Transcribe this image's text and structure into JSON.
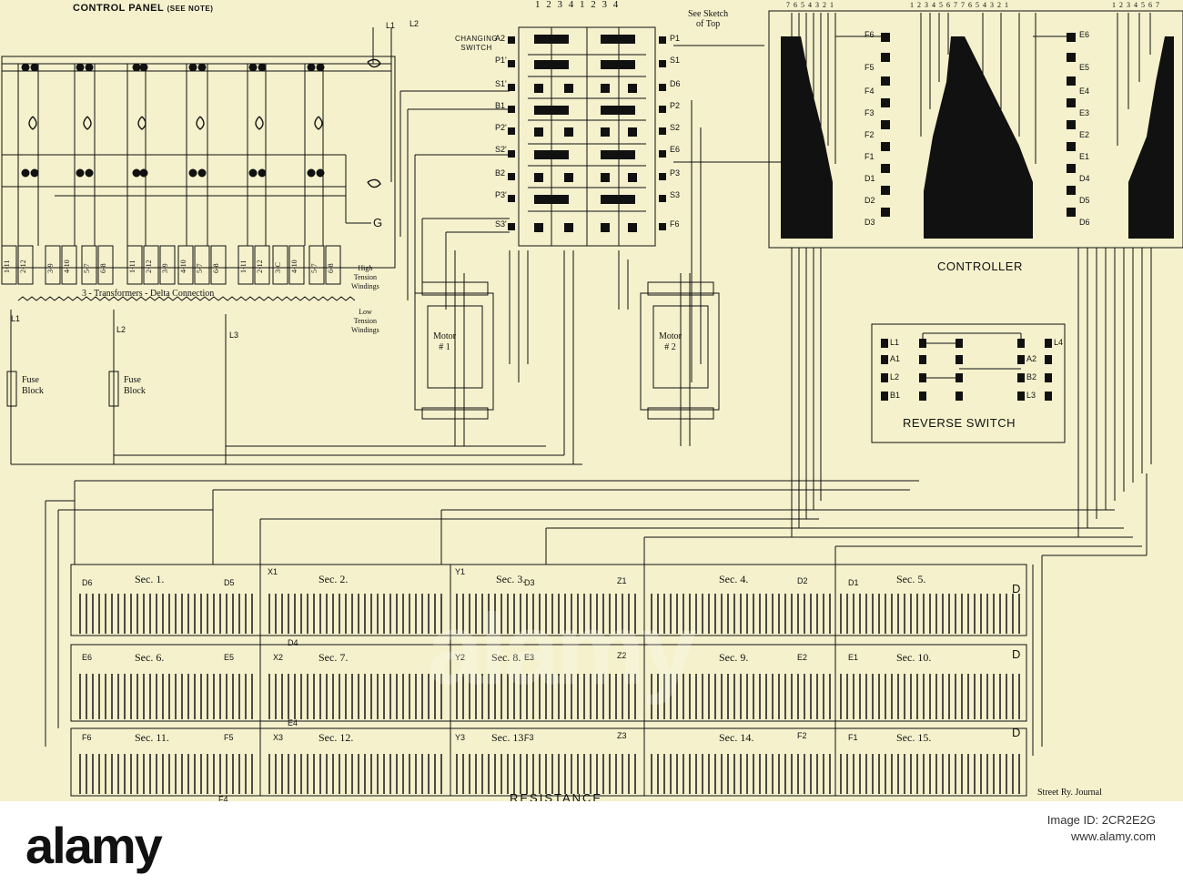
{
  "diagram": {
    "control_panel": {
      "title": "CONTROL PANEL",
      "note": "(SEE NOTE)",
      "transformers_label": "3 - Transformers - Delta Connection",
      "high_tension": [
        "High",
        "Tension",
        "Windings"
      ],
      "low_tension": [
        "Low",
        "Tension",
        "Windings"
      ],
      "g_label": "G",
      "supply": [
        "L1",
        "L2",
        "L3"
      ],
      "top_lines": [
        "L1",
        "L2"
      ],
      "fuse": [
        "Fuse",
        "Block"
      ],
      "bottom_tags": [
        "1-11",
        "2-12",
        "3-9",
        "4-10",
        "5-7",
        "6-8",
        "1-11",
        "2-12",
        "3-9",
        "4-10",
        "5-7",
        "6-8",
        "1-11",
        "2-12",
        "3-C",
        "4-10",
        "5-7",
        "6-8"
      ]
    },
    "changing_switch": {
      "title_lines": [
        "CHANGING",
        "SWITCH"
      ],
      "top_numbers": "1 2 3 4  1 2 3 4",
      "sketch_note": [
        "See Sketch",
        "of Top"
      ],
      "left_terms": [
        "A2",
        "P1'",
        "S1'",
        "B1",
        "P2'",
        "S2'",
        "B2",
        "P3'",
        "S3'"
      ],
      "right_terms": [
        "P1",
        "S1",
        "D6",
        "P2",
        "S2",
        "E6",
        "P3",
        "S3",
        "F6"
      ]
    },
    "motors": [
      {
        "lines": [
          "Motor",
          "# 1"
        ]
      },
      {
        "lines": [
          "Motor",
          "# 2"
        ]
      }
    ],
    "controller": {
      "title": "CONTROLLER",
      "numbers": [
        "7 6 5 4 3 2 1",
        "1 2 3 4 5 6 7   7 6 5 4 3 2 1",
        "1 2 3 4 5 6 7"
      ],
      "left_terms": [
        "F6",
        "F5",
        "F4",
        "F3",
        "F2",
        "F1",
        "D1",
        "D2",
        "D3"
      ],
      "right_terms": [
        "E6",
        "E5",
        "E4",
        "E3",
        "E2",
        "E1",
        "D4",
        "D5",
        "D6"
      ]
    },
    "reverse_switch": {
      "title": "REVERSE SWITCH",
      "terms": [
        "L1",
        "L4",
        "A1",
        "A2",
        "L2",
        "B2",
        "B1",
        "L3"
      ]
    },
    "resistance": {
      "title": "RESISTANCE",
      "sections": [
        "Sec. 1.",
        "Sec. 2.",
        "Sec. 3.",
        "Sec. 4.",
        "Sec. 5.",
        "Sec. 6.",
        "Sec. 7.",
        "Sec. 8.",
        "Sec. 9.",
        "Sec. 10.",
        "Sec. 11.",
        "Sec. 12.",
        "Sec. 13.",
        "Sec. 14.",
        "Sec. 15."
      ],
      "terms": [
        "D6",
        "D5",
        "X1",
        "Y1",
        "D3",
        "Z1",
        "D2",
        "D1",
        "E6",
        "E5",
        "X2",
        "D4",
        "Y2",
        "E3",
        "Z2",
        "E2",
        "E1",
        "F6",
        "F5",
        "X3",
        "E4",
        "Y3",
        "F3",
        "Z3",
        "F2",
        "F1",
        "F4"
      ],
      "d_labels": [
        "D",
        "D",
        "D"
      ]
    },
    "credit": "Street Ry. Journal"
  },
  "footer": {
    "logo": "alamy",
    "image_id_label": "Image ID: 2CR2E2G",
    "site": "www.alamy.com"
  },
  "watermark": "alamy"
}
